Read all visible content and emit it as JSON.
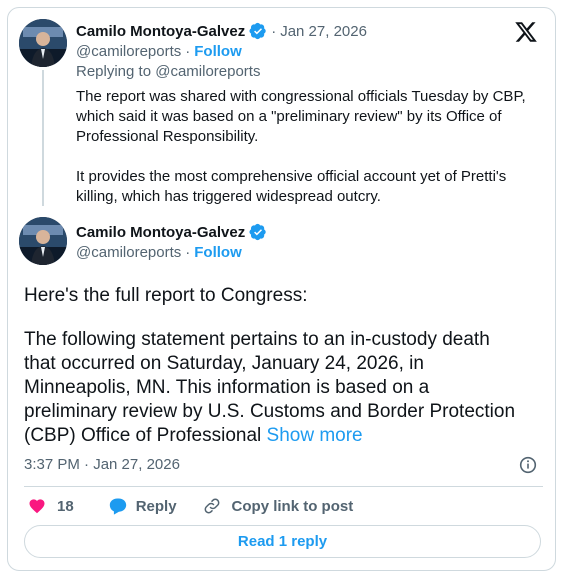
{
  "parent": {
    "name": "Camilo Montoya-Galvez",
    "handle": "@camiloreports",
    "follow_label": "Follow",
    "date": "Jan 27, 2026",
    "replying_to": "Replying to @camiloreports",
    "paragraph_1": [
      "The report was shared with congressional officials Tuesday by CBP,",
      "which said it was based on a \"preliminary review\" by its Office of",
      "Professional Responsibility."
    ],
    "paragraph_2": [
      "It provides the most comprehensive official account yet of Pretti's",
      "killing, which has triggered widespread outcry."
    ]
  },
  "main": {
    "name": "Camilo Montoya-Galvez",
    "handle": "@camiloreports",
    "follow_label": "Follow",
    "line_1": "Here's the full report to Congress:",
    "body_lines": [
      "The following statement pertains to an in-custody death",
      "that occurred on Saturday, January 24, 2026, in",
      "Minneapolis, MN. This information is based on a",
      "preliminary review by U.S. Customs and Border Protection"
    ],
    "last_line": "(CBP) Office of Professional ",
    "show_more": "Show more",
    "timestamp": "3:37 PM · Jan 27, 2026"
  },
  "actions": {
    "likes": "18",
    "reply_label": "Reply",
    "copy_link_label": "Copy link to post",
    "read_reply_label": "Read 1 reply"
  },
  "colors": {
    "accent": "#1d9bf0",
    "like": "#f91880",
    "muted": "#536471",
    "border": "#cfd9de"
  },
  "icons": [
    "verified-badge-icon",
    "x-logo-icon",
    "info-icon",
    "heart-icon",
    "reply-bubble-icon",
    "link-icon"
  ]
}
